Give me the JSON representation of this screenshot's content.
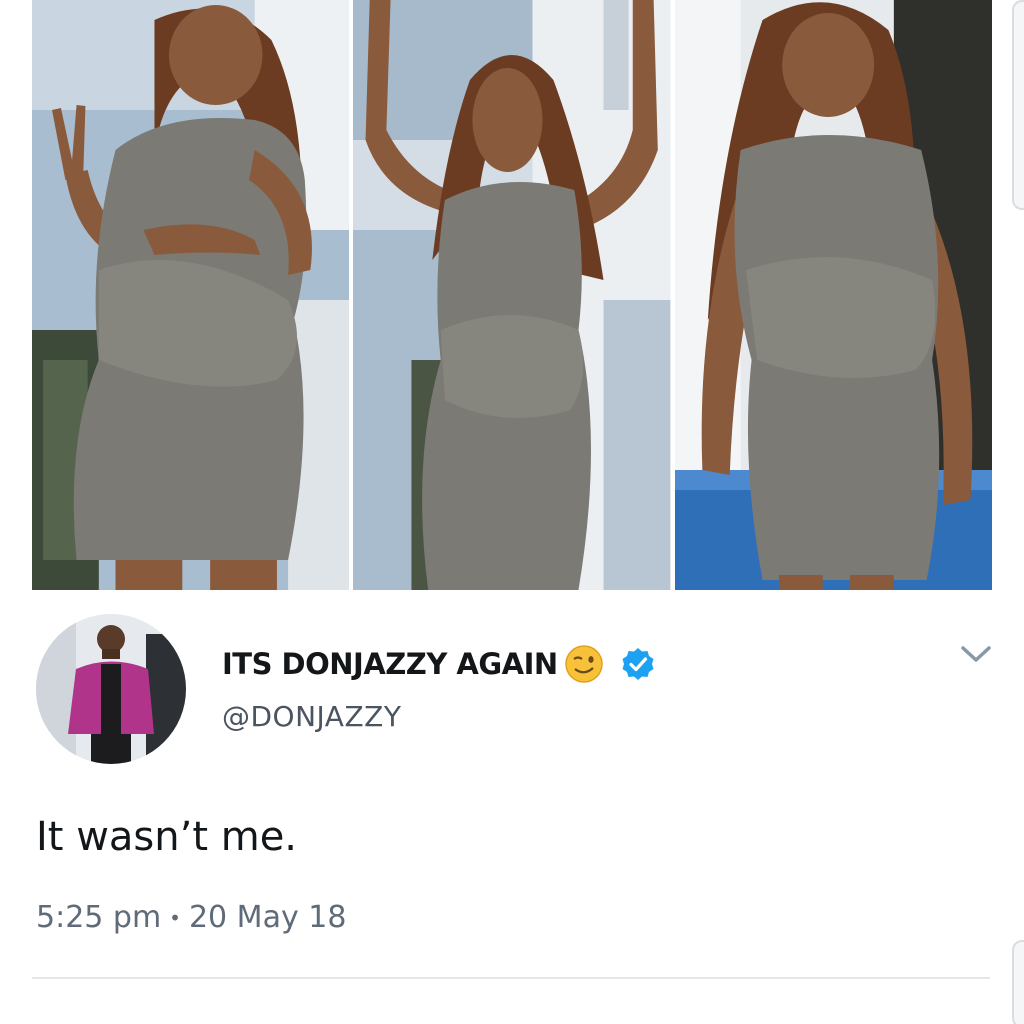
{
  "tweet": {
    "display_name": "ITS DONJAZZY AGAIN",
    "emoji_icon": "winking-face-emoji",
    "verified_icon": "verified-badge-icon",
    "handle": "@DONJAZZY",
    "text": "It wasn’t me.",
    "time": "5:25 pm",
    "separator": "•",
    "date": "20 May 18",
    "menu_icon": "chevron-down-icon"
  },
  "colors": {
    "verified_blue": "#1da1f2",
    "text_primary": "#14171a",
    "text_secondary": "#5f6b78",
    "divider": "#e3e7eb"
  }
}
